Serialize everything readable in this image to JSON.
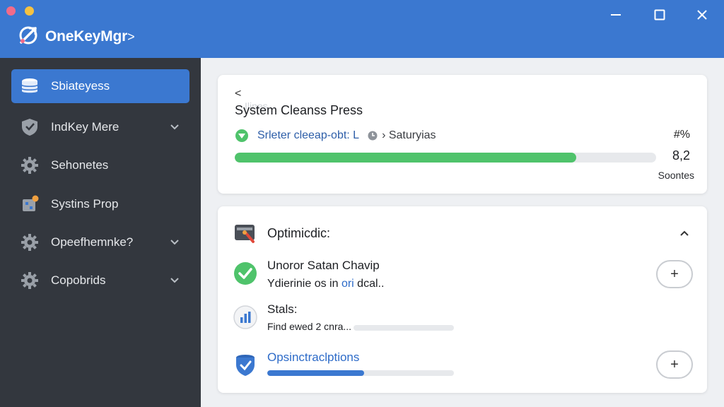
{
  "window": {
    "title": "OneKeyMgr",
    "title_suffix": ">"
  },
  "sidebar": {
    "items": [
      {
        "label": "Sbiateyess",
        "icon": "database-icon",
        "active": true,
        "chevron": false
      },
      {
        "label": "IndKey Mere",
        "icon": "shield-icon",
        "active": false,
        "chevron": true
      },
      {
        "label": "Sehonetes",
        "icon": "gear-icon",
        "active": false,
        "chevron": false
      },
      {
        "label": "Systins Prop",
        "icon": "puzzle-icon",
        "active": false,
        "chevron": false
      },
      {
        "label": "Opeefhemnke?",
        "icon": "gear-icon",
        "active": false,
        "chevron": true
      },
      {
        "label": "Copobrids",
        "icon": "gear-icon",
        "active": false,
        "chevron": true
      }
    ]
  },
  "progress_card": {
    "back_label": "<",
    "back_label_faded": "Ilines",
    "title": "System Cleanss Press",
    "status_text": "Srleter cleeap-obt: L",
    "status_text_2": "Saturyias",
    "percent_label": "#%",
    "progress": 0.81,
    "value": "8,2",
    "unit": "Soontes"
  },
  "options_card": {
    "title": "Optimicdic:",
    "rows": [
      {
        "title": "Unoror Satan Chavip",
        "sub_pre": "Ydierinie os in ",
        "sub_link": "ori",
        "sub_post": " dcal..",
        "icon": "check-circle-icon",
        "has_plus": true
      },
      {
        "title": "Stals:",
        "sub": "Find ewed 2 cnra...",
        "icon": "bar-chart-icon",
        "bar": 0.0,
        "has_plus": false
      },
      {
        "title": "Opsinctraclptions",
        "icon": "shield-check-icon",
        "bar": 0.52,
        "has_plus": true
      }
    ]
  },
  "colors": {
    "accent": "#3b78d0",
    "progress_green": "#4fc36b",
    "sidebar_bg": "#33373e"
  }
}
